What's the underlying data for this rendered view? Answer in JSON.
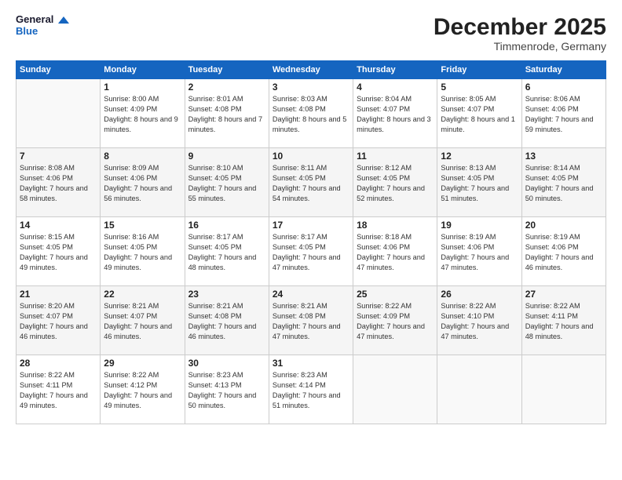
{
  "logo": {
    "line1": "General",
    "line2": "Blue"
  },
  "title": "December 2025",
  "subtitle": "Timmenrode, Germany",
  "days_of_week": [
    "Sunday",
    "Monday",
    "Tuesday",
    "Wednesday",
    "Thursday",
    "Friday",
    "Saturday"
  ],
  "weeks": [
    [
      {
        "day": "",
        "sunrise": "",
        "sunset": "",
        "daylight": ""
      },
      {
        "day": "1",
        "sunrise": "Sunrise: 8:00 AM",
        "sunset": "Sunset: 4:09 PM",
        "daylight": "Daylight: 8 hours and 9 minutes."
      },
      {
        "day": "2",
        "sunrise": "Sunrise: 8:01 AM",
        "sunset": "Sunset: 4:08 PM",
        "daylight": "Daylight: 8 hours and 7 minutes."
      },
      {
        "day": "3",
        "sunrise": "Sunrise: 8:03 AM",
        "sunset": "Sunset: 4:08 PM",
        "daylight": "Daylight: 8 hours and 5 minutes."
      },
      {
        "day": "4",
        "sunrise": "Sunrise: 8:04 AM",
        "sunset": "Sunset: 4:07 PM",
        "daylight": "Daylight: 8 hours and 3 minutes."
      },
      {
        "day": "5",
        "sunrise": "Sunrise: 8:05 AM",
        "sunset": "Sunset: 4:07 PM",
        "daylight": "Daylight: 8 hours and 1 minute."
      },
      {
        "day": "6",
        "sunrise": "Sunrise: 8:06 AM",
        "sunset": "Sunset: 4:06 PM",
        "daylight": "Daylight: 7 hours and 59 minutes."
      }
    ],
    [
      {
        "day": "7",
        "sunrise": "Sunrise: 8:08 AM",
        "sunset": "Sunset: 4:06 PM",
        "daylight": "Daylight: 7 hours and 58 minutes."
      },
      {
        "day": "8",
        "sunrise": "Sunrise: 8:09 AM",
        "sunset": "Sunset: 4:06 PM",
        "daylight": "Daylight: 7 hours and 56 minutes."
      },
      {
        "day": "9",
        "sunrise": "Sunrise: 8:10 AM",
        "sunset": "Sunset: 4:05 PM",
        "daylight": "Daylight: 7 hours and 55 minutes."
      },
      {
        "day": "10",
        "sunrise": "Sunrise: 8:11 AM",
        "sunset": "Sunset: 4:05 PM",
        "daylight": "Daylight: 7 hours and 54 minutes."
      },
      {
        "day": "11",
        "sunrise": "Sunrise: 8:12 AM",
        "sunset": "Sunset: 4:05 PM",
        "daylight": "Daylight: 7 hours and 52 minutes."
      },
      {
        "day": "12",
        "sunrise": "Sunrise: 8:13 AM",
        "sunset": "Sunset: 4:05 PM",
        "daylight": "Daylight: 7 hours and 51 minutes."
      },
      {
        "day": "13",
        "sunrise": "Sunrise: 8:14 AM",
        "sunset": "Sunset: 4:05 PM",
        "daylight": "Daylight: 7 hours and 50 minutes."
      }
    ],
    [
      {
        "day": "14",
        "sunrise": "Sunrise: 8:15 AM",
        "sunset": "Sunset: 4:05 PM",
        "daylight": "Daylight: 7 hours and 49 minutes."
      },
      {
        "day": "15",
        "sunrise": "Sunrise: 8:16 AM",
        "sunset": "Sunset: 4:05 PM",
        "daylight": "Daylight: 7 hours and 49 minutes."
      },
      {
        "day": "16",
        "sunrise": "Sunrise: 8:17 AM",
        "sunset": "Sunset: 4:05 PM",
        "daylight": "Daylight: 7 hours and 48 minutes."
      },
      {
        "day": "17",
        "sunrise": "Sunrise: 8:17 AM",
        "sunset": "Sunset: 4:05 PM",
        "daylight": "Daylight: 7 hours and 47 minutes."
      },
      {
        "day": "18",
        "sunrise": "Sunrise: 8:18 AM",
        "sunset": "Sunset: 4:06 PM",
        "daylight": "Daylight: 7 hours and 47 minutes."
      },
      {
        "day": "19",
        "sunrise": "Sunrise: 8:19 AM",
        "sunset": "Sunset: 4:06 PM",
        "daylight": "Daylight: 7 hours and 47 minutes."
      },
      {
        "day": "20",
        "sunrise": "Sunrise: 8:19 AM",
        "sunset": "Sunset: 4:06 PM",
        "daylight": "Daylight: 7 hours and 46 minutes."
      }
    ],
    [
      {
        "day": "21",
        "sunrise": "Sunrise: 8:20 AM",
        "sunset": "Sunset: 4:07 PM",
        "daylight": "Daylight: 7 hours and 46 minutes."
      },
      {
        "day": "22",
        "sunrise": "Sunrise: 8:21 AM",
        "sunset": "Sunset: 4:07 PM",
        "daylight": "Daylight: 7 hours and 46 minutes."
      },
      {
        "day": "23",
        "sunrise": "Sunrise: 8:21 AM",
        "sunset": "Sunset: 4:08 PM",
        "daylight": "Daylight: 7 hours and 46 minutes."
      },
      {
        "day": "24",
        "sunrise": "Sunrise: 8:21 AM",
        "sunset": "Sunset: 4:08 PM",
        "daylight": "Daylight: 7 hours and 47 minutes."
      },
      {
        "day": "25",
        "sunrise": "Sunrise: 8:22 AM",
        "sunset": "Sunset: 4:09 PM",
        "daylight": "Daylight: 7 hours and 47 minutes."
      },
      {
        "day": "26",
        "sunrise": "Sunrise: 8:22 AM",
        "sunset": "Sunset: 4:10 PM",
        "daylight": "Daylight: 7 hours and 47 minutes."
      },
      {
        "day": "27",
        "sunrise": "Sunrise: 8:22 AM",
        "sunset": "Sunset: 4:11 PM",
        "daylight": "Daylight: 7 hours and 48 minutes."
      }
    ],
    [
      {
        "day": "28",
        "sunrise": "Sunrise: 8:22 AM",
        "sunset": "Sunset: 4:11 PM",
        "daylight": "Daylight: 7 hours and 49 minutes."
      },
      {
        "day": "29",
        "sunrise": "Sunrise: 8:22 AM",
        "sunset": "Sunset: 4:12 PM",
        "daylight": "Daylight: 7 hours and 49 minutes."
      },
      {
        "day": "30",
        "sunrise": "Sunrise: 8:23 AM",
        "sunset": "Sunset: 4:13 PM",
        "daylight": "Daylight: 7 hours and 50 minutes."
      },
      {
        "day": "31",
        "sunrise": "Sunrise: 8:23 AM",
        "sunset": "Sunset: 4:14 PM",
        "daylight": "Daylight: 7 hours and 51 minutes."
      },
      {
        "day": "",
        "sunrise": "",
        "sunset": "",
        "daylight": ""
      },
      {
        "day": "",
        "sunrise": "",
        "sunset": "",
        "daylight": ""
      },
      {
        "day": "",
        "sunrise": "",
        "sunset": "",
        "daylight": ""
      }
    ]
  ]
}
